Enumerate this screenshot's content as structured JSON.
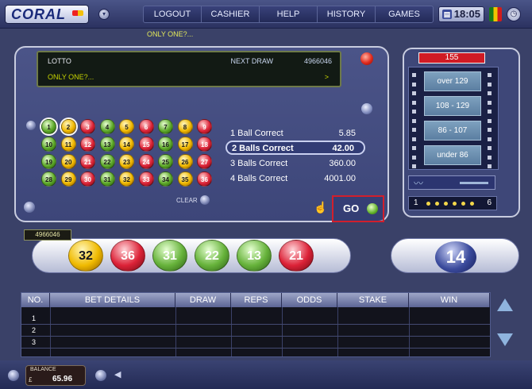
{
  "header": {
    "logo_text": "CORAL",
    "nav": [
      "LOGOUT",
      "CASHIER",
      "HELP",
      "HISTORY",
      "GAMES"
    ],
    "clock": "18:05"
  },
  "ticker": "ONLY ONE?...",
  "info_panel": {
    "game": "LOTTO",
    "next_draw_label": "NEXT DRAW",
    "next_draw_number": "4966046",
    "message": "ONLY ONE?...",
    "arrow": ">"
  },
  "number_grid": [
    {
      "n": "1",
      "c": "green",
      "s": true
    },
    {
      "n": "2",
      "c": "yellow",
      "s": true
    },
    {
      "n": "3",
      "c": "red"
    },
    {
      "n": "4",
      "c": "green"
    },
    {
      "n": "5",
      "c": "yellow"
    },
    {
      "n": "6",
      "c": "red"
    },
    {
      "n": "7",
      "c": "green"
    },
    {
      "n": "8",
      "c": "yellow"
    },
    {
      "n": "9",
      "c": "red"
    },
    {
      "n": "10",
      "c": "green"
    },
    {
      "n": "11",
      "c": "yellow"
    },
    {
      "n": "12",
      "c": "red"
    },
    {
      "n": "13",
      "c": "green"
    },
    {
      "n": "14",
      "c": "yellow"
    },
    {
      "n": "15",
      "c": "red"
    },
    {
      "n": "16",
      "c": "green"
    },
    {
      "n": "17",
      "c": "yellow"
    },
    {
      "n": "18",
      "c": "red"
    },
    {
      "n": "19",
      "c": "green"
    },
    {
      "n": "20",
      "c": "yellow"
    },
    {
      "n": "21",
      "c": "red"
    },
    {
      "n": "22",
      "c": "green"
    },
    {
      "n": "23",
      "c": "yellow"
    },
    {
      "n": "24",
      "c": "red"
    },
    {
      "n": "25",
      "c": "green"
    },
    {
      "n": "26",
      "c": "yellow"
    },
    {
      "n": "27",
      "c": "red"
    },
    {
      "n": "28",
      "c": "green"
    },
    {
      "n": "29",
      "c": "yellow"
    },
    {
      "n": "30",
      "c": "red"
    },
    {
      "n": "31",
      "c": "green"
    },
    {
      "n": "32",
      "c": "yellow"
    },
    {
      "n": "33",
      "c": "red"
    },
    {
      "n": "34",
      "c": "green"
    },
    {
      "n": "35",
      "c": "yellow"
    },
    {
      "n": "36",
      "c": "red"
    }
  ],
  "clear_label": "CLEAR",
  "odds": [
    {
      "label": "1 Ball Correct",
      "value": "5.85",
      "selected": false
    },
    {
      "label": "2 Balls Correct",
      "value": "42.00",
      "selected": true
    },
    {
      "label": "3 Balls Correct",
      "value": "360.00",
      "selected": false
    },
    {
      "label": "4 Balls Correct",
      "value": "4001.00",
      "selected": false
    }
  ],
  "go_label": "GO",
  "tower": {
    "top_value": "155",
    "bars": [
      "over 129",
      "108 - 129",
      "86 - 107",
      "under 86"
    ],
    "range_min": "1",
    "range_max": "6"
  },
  "draw": {
    "draw_id": "4966046",
    "balls": [
      {
        "n": "32",
        "c": "yellow"
      },
      {
        "n": "36",
        "c": "red"
      },
      {
        "n": "31",
        "c": "green"
      },
      {
        "n": "22",
        "c": "green"
      },
      {
        "n": "13",
        "c": "green"
      },
      {
        "n": "21",
        "c": "red"
      }
    ],
    "count": "14"
  },
  "bets_table": {
    "headers": [
      "NO.",
      "BET DETAILS",
      "DRAW",
      "REPS",
      "ODDS",
      "STAKE",
      "WIN"
    ],
    "rows": [
      "1",
      "2",
      "3"
    ]
  },
  "footer": {
    "balance_label": "BALANCE",
    "currency": "£",
    "balance_value": "65.96"
  }
}
